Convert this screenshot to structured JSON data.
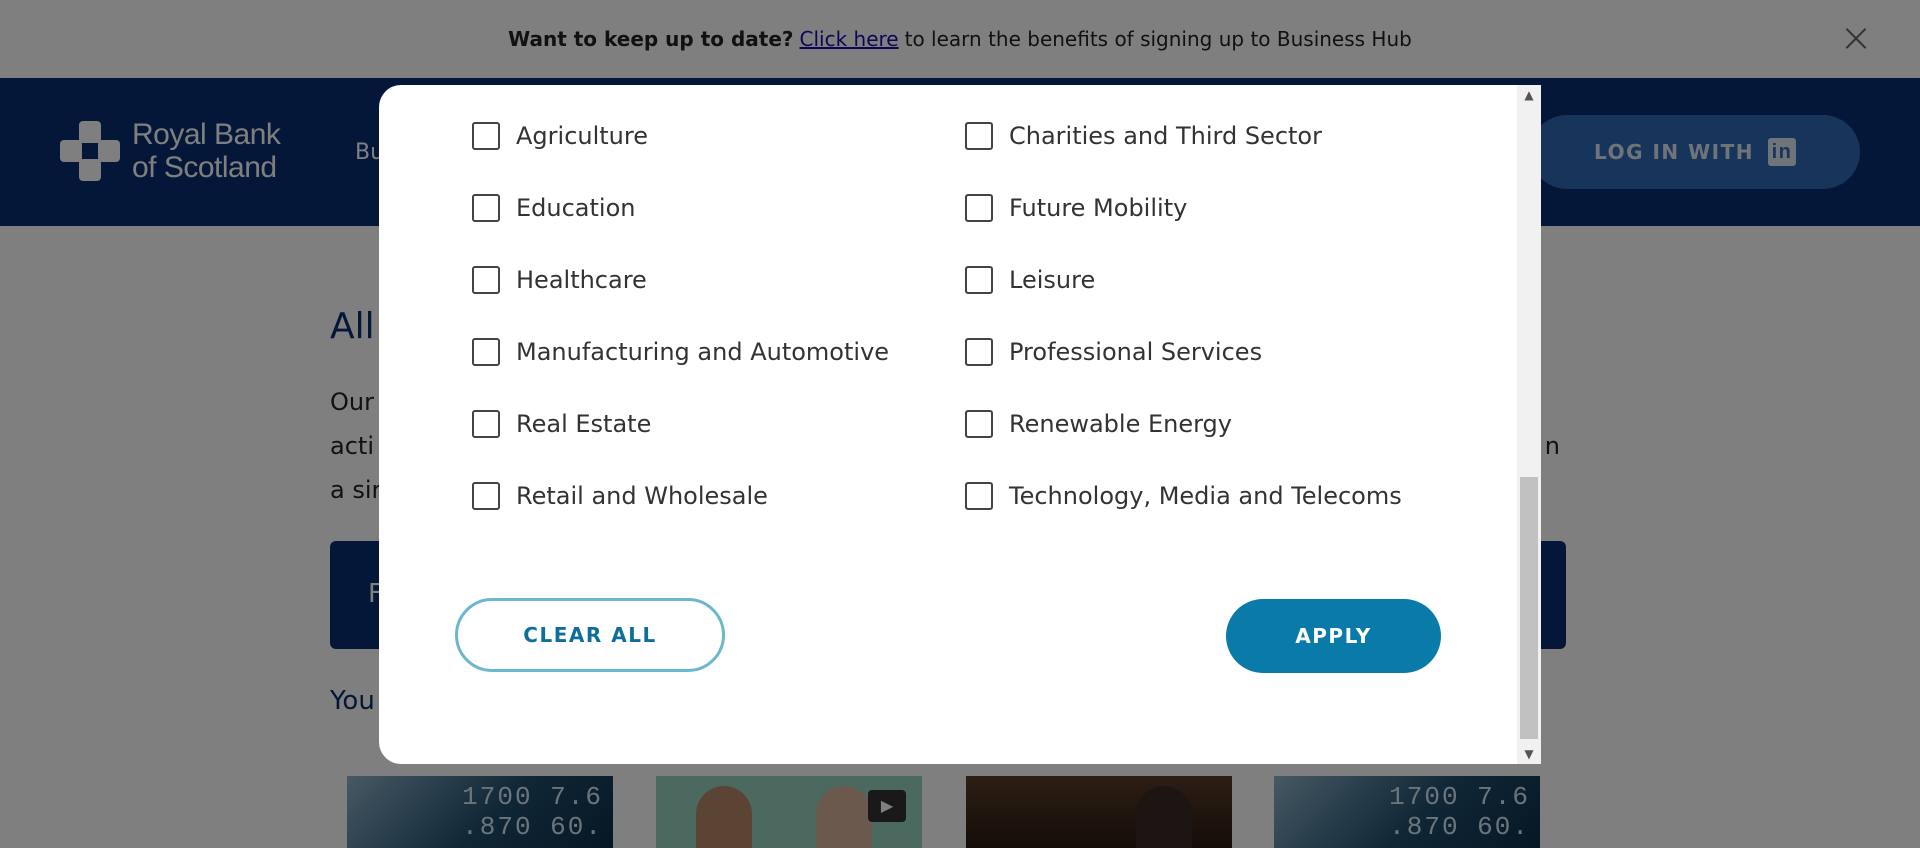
{
  "banner": {
    "lead": "Want to keep up to date?",
    "link": "Click here",
    "tail": "to learn the benefits of signing up to Business Hub",
    "close_glyph": "×"
  },
  "header": {
    "logo_line1": "Royal Bank",
    "logo_line2": "of Scotland",
    "nav_fragment": "Bu",
    "login_label": "LOG IN WITH",
    "login_icon": "in"
  },
  "page": {
    "title_fragment": "All",
    "para_line1": "Our",
    "para_line2": "acti",
    "para_line3": "a sir",
    "para_right_fragment": "n",
    "filter_fragment": "F",
    "you_fragment": "You"
  },
  "modal": {
    "options_left": [
      "Agriculture",
      "Education",
      "Healthcare",
      "Manufacturing and Automotive",
      "Real Estate",
      "Retail and Wholesale"
    ],
    "options_right": [
      "Charities and Third Sector",
      "Future Mobility",
      "Leisure",
      "Professional Services",
      "Renewable Energy",
      "Technology, Media and Telecoms"
    ],
    "clear_label": "CLEAR ALL",
    "apply_label": "APPLY"
  },
  "icons": {
    "close": "close-icon",
    "linkedin": "linkedin-icon",
    "play": "play-icon"
  },
  "colors": {
    "brand_navy": "#0a2f73",
    "accent_teal": "#0a7aa8",
    "linkedin_blue": "#2e6bb5"
  }
}
